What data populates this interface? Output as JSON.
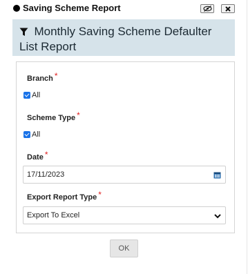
{
  "dialog": {
    "title": "Saving Scheme Report",
    "banner_title": "Monthly Saving Scheme Defaulter List Report"
  },
  "form": {
    "branch": {
      "label": "Branch",
      "required_mark": "*",
      "all_label": "All",
      "all_checked": true
    },
    "scheme_type": {
      "label": "Scheme Type",
      "required_mark": "*",
      "all_label": "All",
      "all_checked": true
    },
    "date": {
      "label": "Date",
      "required_mark": "*",
      "value": "17/11/2023"
    },
    "export_type": {
      "label": "Export Report Type",
      "required_mark": "*",
      "selected": "Export To Excel"
    }
  },
  "actions": {
    "ok_label": "OK"
  },
  "icons": {
    "title_bullet": "filled-circle-icon",
    "hide": "eye-slash-icon",
    "close": "close-icon",
    "filter": "filter-icon",
    "calendar": "calendar-icon",
    "dropdown": "chevron-down-icon"
  },
  "colors": {
    "banner_bg": "#d6e3ea",
    "required": "#e02020",
    "checkbox": "#1a73e8",
    "calendar_icon": "#2a6fb0"
  }
}
